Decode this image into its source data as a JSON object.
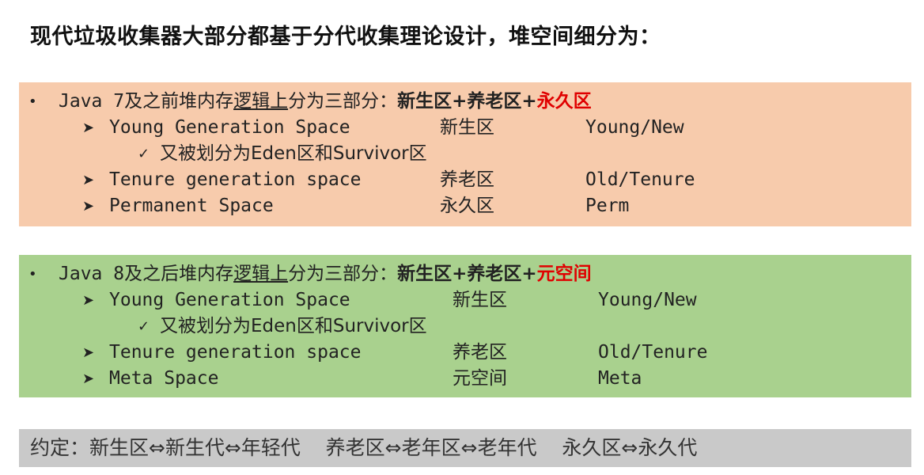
{
  "title": "现代垃圾收集器大部分都基于分代收集理论设计，堆空间细分为：",
  "java7": {
    "bullet": "•",
    "prefix": "Java 7",
    "desc_a": "及之前堆内存",
    "desc_underlined": "逻辑上",
    "desc_b": "分为三部分：",
    "bold_a": "新生区+养老区+",
    "bold_red": "永久区",
    "rows": [
      {
        "marker": "➤",
        "name": "Young Generation Space",
        "cn": "新生区",
        "en": "Young/New"
      },
      {
        "marker": "✓",
        "name": "又被划分为Eden区和Survivor区",
        "cn": "",
        "en": ""
      },
      {
        "marker": "➤",
        "name": "Tenure generation space",
        "cn": "养老区",
        "en": "Old/Tenure"
      },
      {
        "marker": "➤",
        "name": "Permanent Space",
        "cn": "永久区",
        "en": "Perm"
      }
    ]
  },
  "java8": {
    "bullet": "•",
    "prefix": "Java 8",
    "desc_a": "及之后堆内存",
    "desc_underlined": "逻辑上",
    "desc_b": "分为三部分：",
    "bold_a": "新生区+养老区+",
    "bold_red": "元空间",
    "rows": [
      {
        "marker": "➤",
        "name": "Young Generation Space",
        "cn": "新生区",
        "en": "Young/New"
      },
      {
        "marker": "✓",
        "name": "又被划分为Eden区和Survivor区",
        "cn": "",
        "en": ""
      },
      {
        "marker": "➤",
        "name": "Tenure generation space",
        "cn": "养老区",
        "en": "Old/Tenure"
      },
      {
        "marker": "➤",
        "name": "Meta Space",
        "cn": "元空间",
        "en": "Meta"
      }
    ]
  },
  "note": "约定：新生区⇔新生代⇔年轻代    养老区⇔老年区⇔老年代    永久区⇔永久代",
  "colors": {
    "java7_bg": "#f7cbac",
    "java8_bg": "#a9d18e",
    "note_bg": "#c9c9c9",
    "highlight_red": "#e00000"
  }
}
